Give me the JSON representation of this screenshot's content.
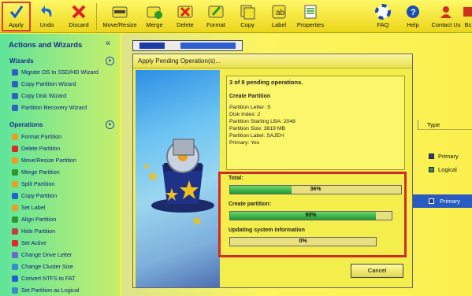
{
  "toolbar": {
    "buttons": [
      "Apply",
      "Undo",
      "Discard",
      "Move/Resize",
      "Merge",
      "Delete",
      "Format",
      "Copy",
      "Label",
      "Properties"
    ],
    "right_buttons": [
      "FAQ",
      "Help",
      "Contact Us",
      "Bc"
    ]
  },
  "sidebar": {
    "title": "Actions and Wizards",
    "collapse_glyph": "«",
    "wizards_title": "Wizards",
    "wizards": [
      "Migrate OS to SSD/HD Wizard",
      "Copy Partition Wizard",
      "Copy Disk Wizard",
      "Partition Recovery Wizard"
    ],
    "operations_title": "Operations",
    "operations": [
      "Format Partition",
      "Delete Partition",
      "Move/Resize Partition",
      "Merge Partition",
      "Split Partition",
      "Copy Partition",
      "Set Label",
      "Align Partition",
      "Hide Partition",
      "Set Active",
      "Change Drive Letter",
      "Change Cluster Size",
      "Convert NTFS to FAT",
      "Set Partition as Logical"
    ],
    "operation_colors": [
      "#e8a020",
      "#e02828",
      "#e8a020",
      "#2a9a2a",
      "#e8a020",
      "#2060d0",
      "#e8a020",
      "#2a9a2a",
      "#c04040",
      "#e02828",
      "#6a6ad0",
      "#3a8ad0",
      "#2060d0",
      "#3a8ad0"
    ]
  },
  "dialog": {
    "title": "Apply Pending Operation(s)...",
    "count": "3 of 8 pending operations.",
    "current": "Create Partition",
    "props": [
      "Partition Letter: S",
      "Disk Index: 2",
      "Partition Starting LBA: 2048",
      "Partition Size: 3819 MB",
      "Partition Label: SAJEH",
      "Primary: Yes"
    ],
    "total_label": "Total:",
    "total_pct": "36%",
    "total_frac": 0.36,
    "step_label": "Create partition:",
    "step_pct": "90%",
    "step_frac": 0.9,
    "update_label": "Updating system information",
    "update_pct": "0%",
    "update_frac": 0.0,
    "cancel": "Cancel"
  },
  "grid": {
    "type_header": "Type",
    "legend": [
      "Primary",
      "Logical"
    ],
    "selected_type": "Primary",
    "colors": {
      "primary": "#2a3a8a",
      "logical": "#3a8a5a",
      "selected_bg": "#2a5bc0"
    }
  }
}
